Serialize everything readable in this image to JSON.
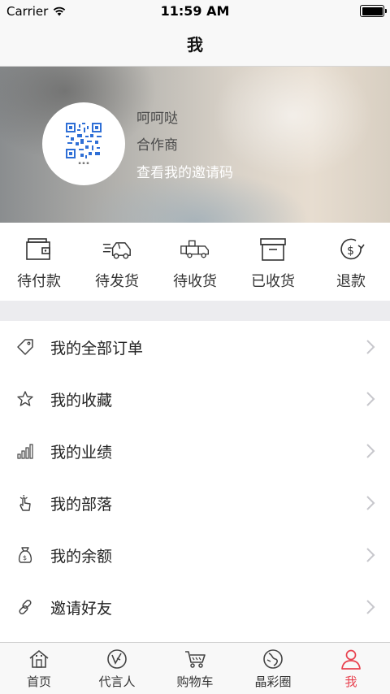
{
  "status_bar": {
    "carrier": "Carrier",
    "time": "11:59 AM"
  },
  "nav": {
    "title": "我"
  },
  "profile": {
    "name": "呵呵哒",
    "role": "合作商",
    "invite_link": "查看我的邀请码"
  },
  "orders": [
    {
      "label": "待付款",
      "icon": "wallet-icon"
    },
    {
      "label": "待发货",
      "icon": "delivery-truck-icon"
    },
    {
      "label": "待收货",
      "icon": "receive-truck-icon"
    },
    {
      "label": "已收货",
      "icon": "box-icon"
    },
    {
      "label": "退款",
      "icon": "refund-icon"
    }
  ],
  "menu": [
    {
      "label": "我的全部订单",
      "icon": "tag-icon"
    },
    {
      "label": "我的收藏",
      "icon": "star-icon"
    },
    {
      "label": "我的业绩",
      "icon": "bar-signal-icon"
    },
    {
      "label": "我的部落",
      "icon": "hand-tap-icon"
    },
    {
      "label": "我的余额",
      "icon": "money-bag-icon"
    },
    {
      "label": "邀请好友",
      "icon": "link-icon"
    }
  ],
  "tabs": [
    {
      "label": "首页",
      "icon": "home-icon",
      "active": false
    },
    {
      "label": "代言人",
      "icon": "spokesperson-icon",
      "active": false
    },
    {
      "label": "购物车",
      "icon": "cart-icon",
      "active": false
    },
    {
      "label": "晶彩圈",
      "icon": "circle-icon",
      "active": false
    },
    {
      "label": "我",
      "icon": "user-icon",
      "active": true
    }
  ],
  "colors": {
    "accent": "#e8424f",
    "separator": "#ececef",
    "bar_bg": "#f8f8f8"
  }
}
